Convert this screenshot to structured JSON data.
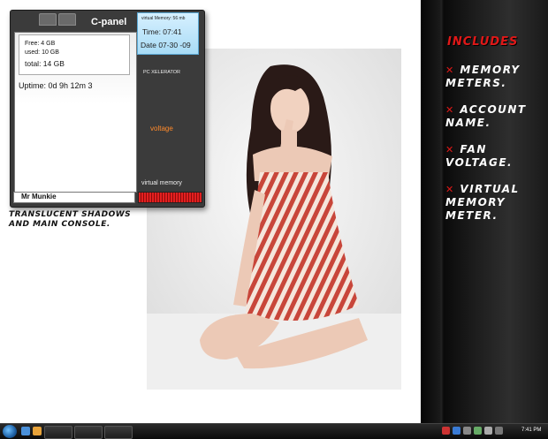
{
  "widget": {
    "title": "C-panel",
    "memory": {
      "free": "Free: 4 GB",
      "used": "used: 10 GB",
      "total": "total: 14 GB"
    },
    "uptime": "Uptime: 0d 9h 12m 3",
    "clock": {
      "virtual_memory": "virtual Memory: 56 mb",
      "time": "Time: 07:41",
      "date": "Date 07-30 -09"
    },
    "pc_xelerator": "PC XELERATOR",
    "voltage": "voltage",
    "virtual_memory_label": "virtual memory",
    "account_name": "Mr Munkie"
  },
  "caption": "TRANSLUCENT SHADOWS AND MAIN CONSOLE.",
  "includes": {
    "heading": "INCLUDES",
    "items": [
      {
        "bullet": "✕",
        "text": "MEMORY METERS."
      },
      {
        "bullet": "✕",
        "text": "ACCOUNT NAME."
      },
      {
        "bullet": "✕",
        "text": "FAN VOLTAGE."
      },
      {
        "bullet": "✕",
        "text": "VIRTUAL MEMORY METER."
      }
    ]
  },
  "taskbar": {
    "clock": "7:41 PM"
  },
  "colors": {
    "accent_red": "#e01818",
    "voltage_orange": "#ff8a2b",
    "clock_blue": "#a9dcf6"
  }
}
